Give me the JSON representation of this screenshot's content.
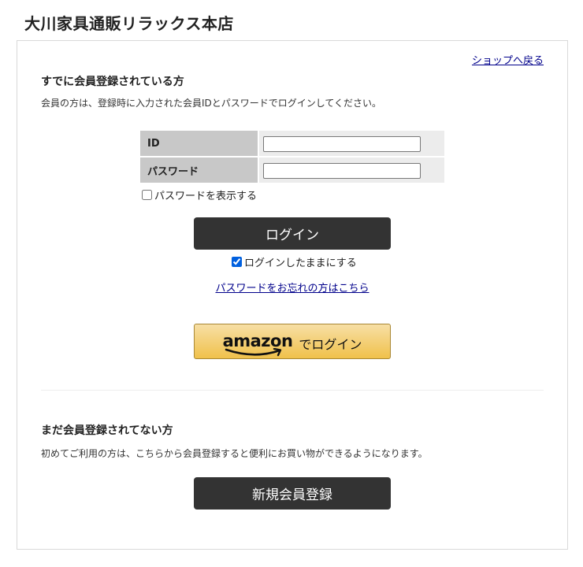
{
  "header": {
    "shop_name": "大川家具通販リラックス本店"
  },
  "panel": {
    "back_link": "ショップへ戻る",
    "member": {
      "heading": "すでに会員登録されている方",
      "description": "会員の方は、登録時に入力された会員IDとパスワードでログインしてください。",
      "id_label": "ID",
      "id_value": "",
      "password_label": "パスワード",
      "password_value": "",
      "show_password_label": "パスワードを表示する",
      "show_password_checked": false,
      "login_button": "ログイン",
      "keep_login_label": "ログインしたままにする",
      "keep_login_checked": true,
      "forgot_link": "パスワードをお忘れの方はこちら",
      "amazon_logo": "amazon",
      "amazon_suffix": "でログイン"
    },
    "new_member": {
      "heading": "まだ会員登録されてない方",
      "description": "初めてご利用の方は、こちらから会員登録すると便利にお買い物ができるようになります。",
      "register_button": "新規会員登録"
    }
  },
  "colors": {
    "dark_button": "#333333",
    "link": "#00008b",
    "amazon_gradient_top": "#f7dfa5",
    "amazon_gradient_bottom": "#f0c14b",
    "amazon_smile": "#ff9900"
  }
}
